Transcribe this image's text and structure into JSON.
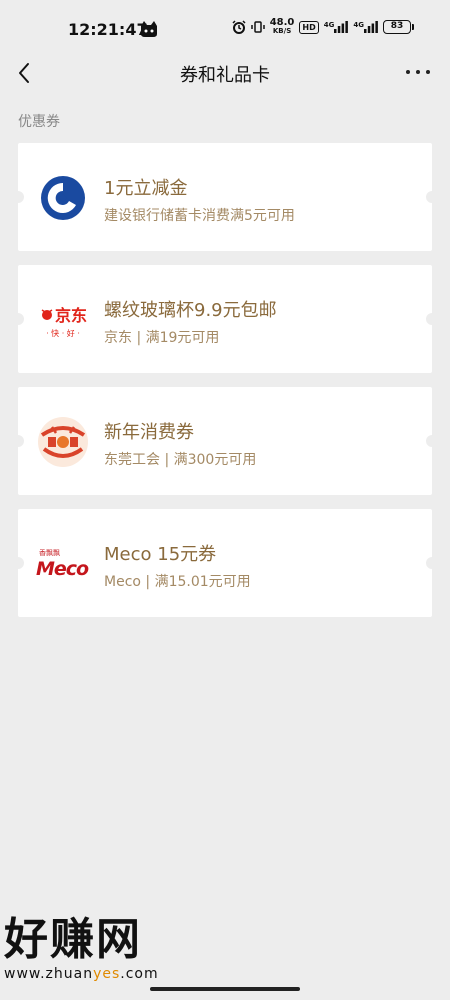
{
  "status_bar": {
    "time": "12:21:47",
    "net_speed_value": "48.0",
    "net_speed_unit": "KB/S",
    "hd_label": "HD",
    "signal_1_label": "4G",
    "signal_2_label": "4G",
    "battery": "83"
  },
  "nav": {
    "title": "券和礼品卡",
    "back_icon": "chevron-left-icon",
    "more_icon": "more-dots-icon"
  },
  "section": {
    "label": "优惠券"
  },
  "coupons": [
    {
      "title": "1元立减金",
      "subtitle": "建设银行储蓄卡消费满5元可用",
      "logo": "ccb-logo"
    },
    {
      "title": "螺纹玻璃杯9.9元包邮",
      "subtitle": "京东 | 满19元可用",
      "logo": "jd-logo",
      "logo_text": "京东",
      "logo_tagline": "· 快 · 好 ·"
    },
    {
      "title": "新年消费券",
      "subtitle": "东莞工会 | 满300元可用",
      "logo": "dongguan-union-seal-logo"
    },
    {
      "title": "Meco 15元券",
      "subtitle": "Meco | 满15.01元可用",
      "logo": "meco-logo",
      "logo_text": "Meco",
      "logo_tagline": "香飘飘"
    }
  ],
  "watermark": {
    "big": "好赚网",
    "url_prefix": "www.zhuan",
    "url_highlight": "yes",
    "url_suffix": ".com"
  },
  "colors": {
    "background": "#ededed",
    "coupon_title": "#8a6a3c",
    "coupon_subtitle": "#a48a65",
    "ccb_blue": "#1a4aa0",
    "jd_red": "#e1251b"
  }
}
